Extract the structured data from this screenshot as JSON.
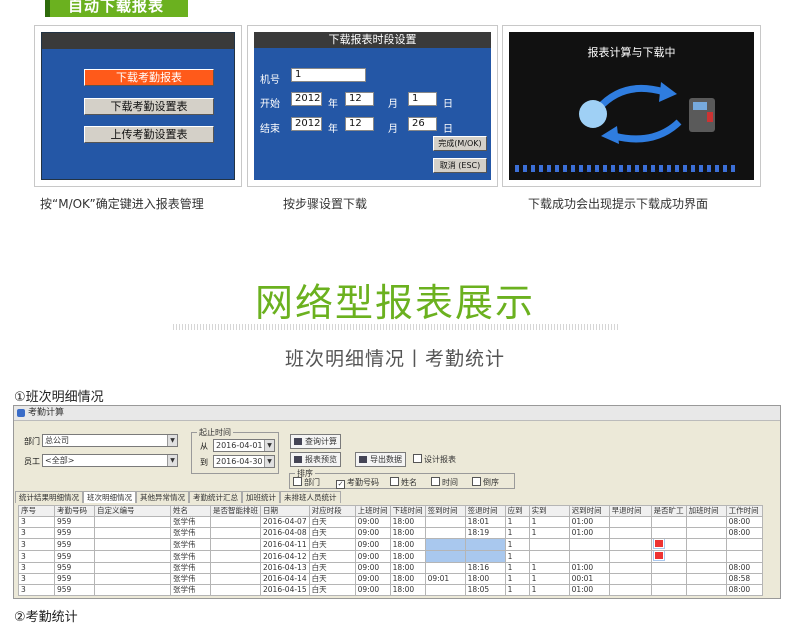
{
  "banner": {
    "label": "自动下载报表"
  },
  "panel1": {
    "buttons": [
      "下载考勤报表",
      "下载考勤设置表",
      "上传考勤设置表"
    ]
  },
  "panel2": {
    "title": "下载报表时段设置",
    "machine_label": "机号",
    "machine_value": "1",
    "start_label": "开始",
    "start_year": "2012",
    "start_month": "12",
    "start_day": "1",
    "end_label": "结束",
    "end_year": "2012",
    "end_month": "12",
    "end_day": "26",
    "year_unit": "年",
    "month_unit": "月",
    "day_unit": "日",
    "ok_label": "完成(M/OK)",
    "cancel_label": "取消 (ESC)"
  },
  "panel3": {
    "title": "报表计算与下载中"
  },
  "captions": [
    "按“M/OK”确定键进入报表管理",
    "按步骤设置下载",
    "下载成功会出现提示下载成功界面"
  ],
  "section": {
    "title": "网络型报表展示",
    "subtitle": "班次明细情况丨考勤统计"
  },
  "headings": {
    "first": "①班次明细情况",
    "second": "②考勤统计"
  },
  "app": {
    "window_title": "考勤计算",
    "dept_label": "部门",
    "dept_value": "总公司",
    "emp_label": "员工",
    "emp_value": "<全部>",
    "range_group": "起止时间",
    "from_label": "从",
    "from_value": "2016-04-01",
    "to_label": "到",
    "to_value": "2016-04-30",
    "buttons": {
      "query": "查询计算",
      "preview": "报表预览",
      "export": "导出数据",
      "design": "设计报表"
    },
    "sort_group": "排序",
    "sort_options": [
      "部门",
      "考勤号码",
      "姓名",
      "时间",
      "倒序"
    ],
    "sort_checked": [
      false,
      true,
      false,
      false,
      false
    ],
    "tabs": [
      "统计结果明细情况",
      "班次明细情况",
      "其他异常情况",
      "考勤统计汇总",
      "加班统计",
      "未排班人员统计"
    ],
    "active_tab": 1,
    "columns": [
      "序号",
      "考勤号码",
      "自定义编号",
      "姓名",
      "是否智能排班",
      "日期",
      "对应时段",
      "上班时间",
      "下班时间",
      "签到时间",
      "签退时间",
      "应到",
      "实到",
      "迟到时间",
      "早退时间",
      "是否旷工",
      "加班时间",
      "工作时间"
    ],
    "rows": [
      [
        "3",
        "959",
        "",
        "张学伟",
        "",
        "2016-04-07",
        "白天",
        "09:00",
        "18:00",
        "",
        "18:01",
        "1",
        "1",
        "01:00",
        "",
        "",
        "",
        "08:00"
      ],
      [
        "3",
        "959",
        "",
        "张学伟",
        "",
        "2016-04-08",
        "白天",
        "09:00",
        "18:00",
        "",
        "18:19",
        "1",
        "1",
        "01:00",
        "",
        "",
        "",
        "08:00"
      ],
      [
        "3",
        "959",
        "",
        "张学伟",
        "",
        "2016-04-11",
        "白天",
        "09:00",
        "18:00",
        "",
        "",
        "1",
        "",
        "",
        "",
        "✓",
        "",
        ""
      ],
      [
        "3",
        "959",
        "",
        "张学伟",
        "",
        "2016-04-12",
        "白天",
        "09:00",
        "18:00",
        "",
        "",
        "1",
        "",
        "",
        "",
        "✓",
        "",
        ""
      ],
      [
        "3",
        "959",
        "",
        "张学伟",
        "",
        "2016-04-13",
        "白天",
        "09:00",
        "18:00",
        "",
        "18:16",
        "1",
        "1",
        "01:00",
        "",
        "",
        "",
        "08:00"
      ],
      [
        "3",
        "959",
        "",
        "张学伟",
        "",
        "2016-04-14",
        "白天",
        "09:00",
        "18:00",
        "09:01",
        "18:00",
        "1",
        "1",
        "00:01",
        "",
        "",
        "",
        "08:58"
      ],
      [
        "3",
        "959",
        "",
        "张学伟",
        "",
        "2016-04-15",
        "白天",
        "09:00",
        "18:00",
        "",
        "18:05",
        "1",
        "1",
        "01:00",
        "",
        "",
        "",
        "08:00"
      ]
    ],
    "highlight_rows": [
      2,
      3
    ]
  },
  "colors": {
    "brand_green": "#6bb11f",
    "device_blue": "#2457a6",
    "active_orange": "#ff5a1a",
    "highlight_blue": "#a9c8ee"
  }
}
